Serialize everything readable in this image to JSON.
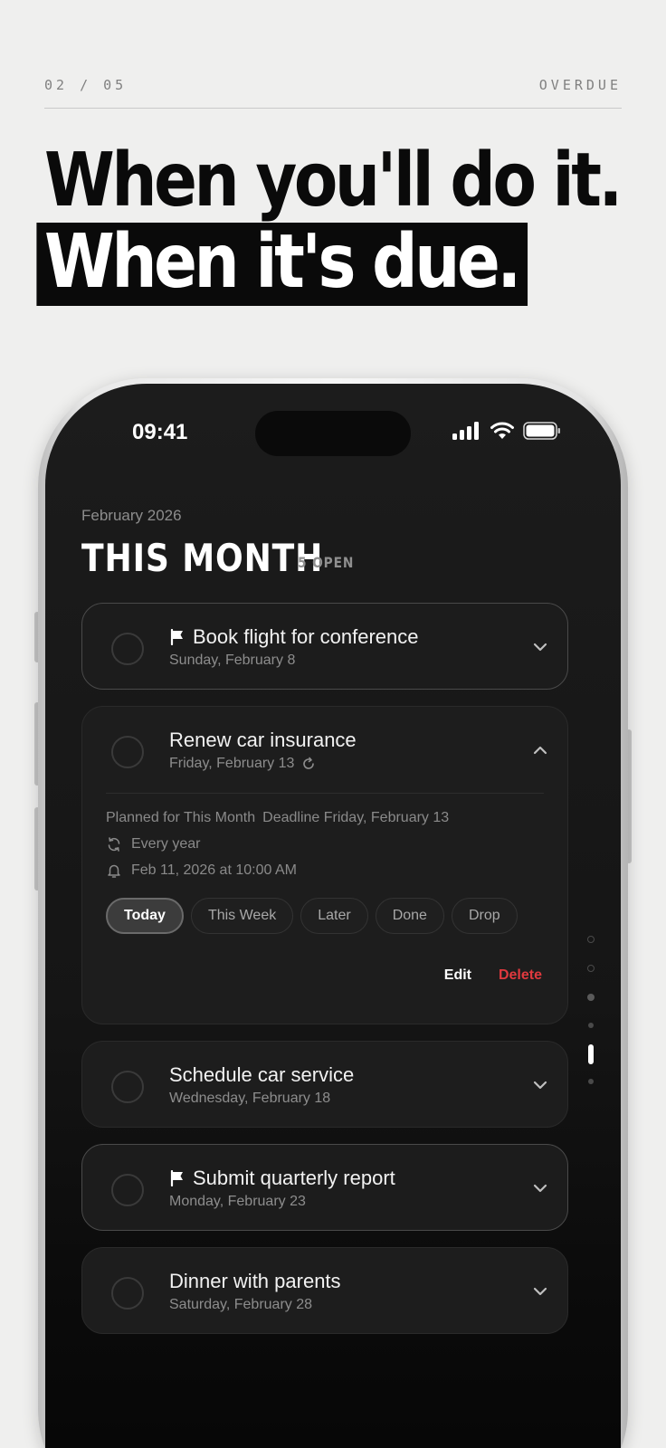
{
  "header": {
    "counter": "02 / 05",
    "tag": "OVERDUE"
  },
  "headline": {
    "line1": "When you'll do it.",
    "line2": "When it's due."
  },
  "status_bar": {
    "time": "09:41"
  },
  "screen": {
    "month_label": "February 2026",
    "title": "THIS MONTH",
    "open_count": "5 OPEN"
  },
  "tasks": [
    {
      "title": "Book flight for conference",
      "date": "Sunday, February 8",
      "flagged": true,
      "icon": "flag-icon"
    },
    {
      "title": "Renew car insurance",
      "date": "Friday, February 13",
      "repeat_icon": "repeat-icon",
      "expanded": true
    },
    {
      "title": "Schedule car service",
      "date": "Wednesday, February 18"
    },
    {
      "title": "Submit quarterly report",
      "date": "Monday, February 23",
      "flagged": true,
      "icon": "flag-icon"
    },
    {
      "title": "Dinner with parents",
      "date": "Saturday, February 28"
    }
  ],
  "expanded_detail": {
    "planned": "Planned for This Month",
    "deadline": "Deadline Friday, February 13",
    "repeat": "Every year",
    "reminder": "Feb 11, 2026 at 10:00 AM",
    "chips": [
      "Today",
      "This Week",
      "Later",
      "Done",
      "Drop"
    ],
    "active_chip": "Today",
    "edit": "Edit",
    "delete": "Delete"
  },
  "page_indicator": {
    "count": 6,
    "active_index": 4
  },
  "colors": {
    "accent_delete": "#e0393e",
    "background": "#efefee",
    "screen": "#151515"
  }
}
